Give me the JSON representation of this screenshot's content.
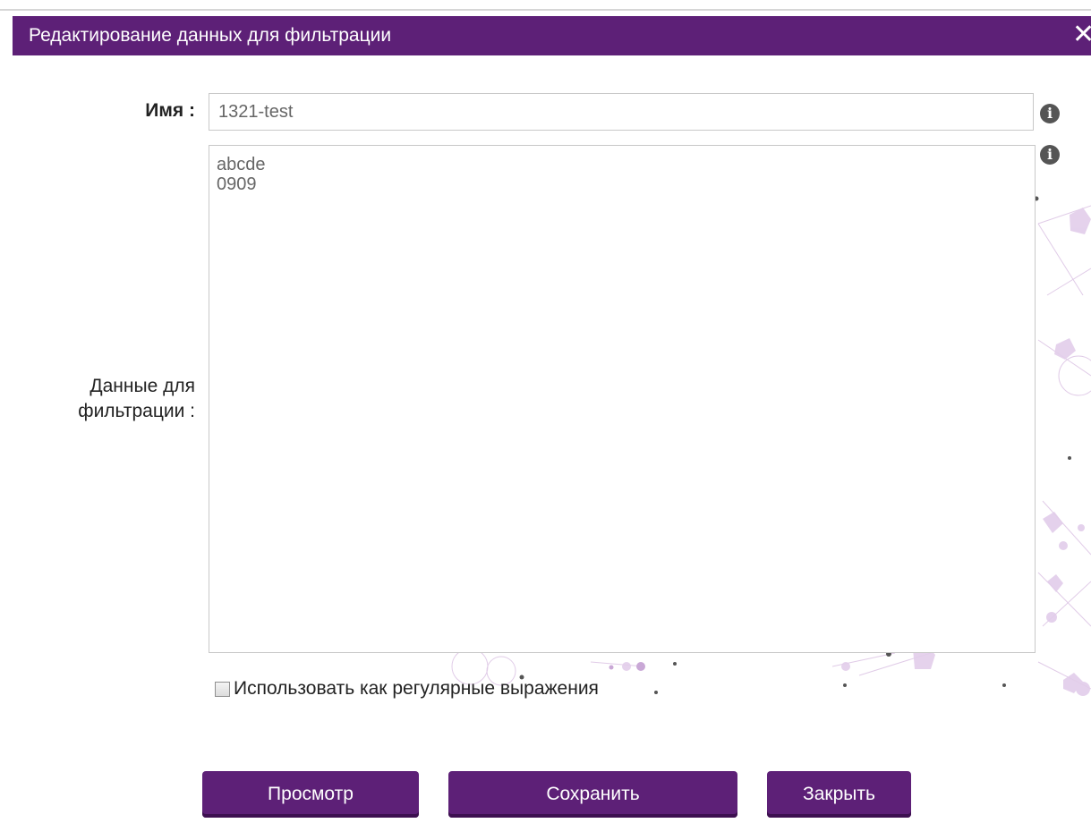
{
  "dialog": {
    "title": "Редактирование данных для фильтрации",
    "close_icon": "close-icon"
  },
  "form": {
    "name_label": "Имя :",
    "name_value": "1321-test",
    "data_label_line1": "Данные для",
    "data_label_line2": "фильтрации :",
    "data_value": "abcde\n0909",
    "info_icon": "info-icon",
    "regex_checked": false,
    "regex_label": "Использовать как регулярные выражения"
  },
  "buttons": {
    "preview": "Просмотр",
    "save": "Сохранить",
    "close": "Закрыть"
  },
  "colors": {
    "accent": "#5d2077",
    "accent_dark": "#3d1050"
  }
}
